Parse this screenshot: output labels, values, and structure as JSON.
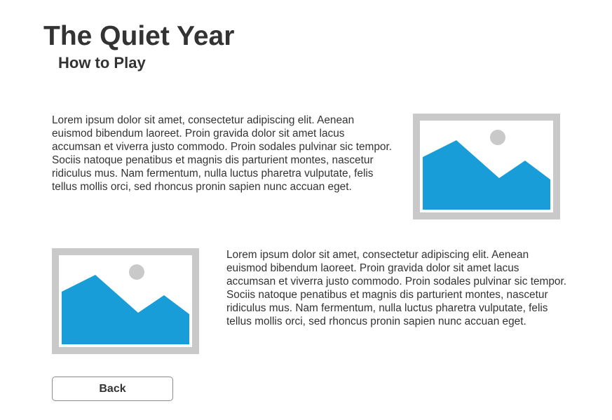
{
  "header": {
    "title": "The Quiet Year",
    "subtitle": "How to Play"
  },
  "sections": [
    {
      "text": "Lorem ipsum dolor sit amet, consectetur adipiscing elit. Aenean euismod bibendum laoreet. Proin gravida dolor sit amet lacus accumsan et viverra justo commodo. Proin sodales pulvinar sic tempor. Sociis natoque penatibus et magnis dis parturient montes, nascetur ridiculus mus. Nam fermentum, nulla luctus pharetra vulputate, felis tellus mollis orci, sed rhoncus pronin sapien nunc accuan eget.",
      "image_icon": "image-placeholder-icon"
    },
    {
      "text": "Lorem ipsum dolor sit amet, consectetur adipiscing elit. Aenean euismod bibendum laoreet. Proin gravida dolor sit amet lacus accumsan et viverra justo commodo. Proin sodales pulvinar sic tempor. Sociis natoque penatibus et magnis dis parturient montes, nascetur ridiculus mus. Nam fermentum, nulla luctus pharetra vulputate, felis tellus mollis orci, sed rhoncus pronin sapien nunc accuan eget.",
      "image_icon": "image-placeholder-icon"
    }
  ],
  "back_button": {
    "label": "Back"
  },
  "colors": {
    "text": "#333333",
    "placeholder_frame": "#c9c9c9",
    "placeholder_mountain": "#189dd8",
    "placeholder_sun": "#c9c9c9"
  }
}
